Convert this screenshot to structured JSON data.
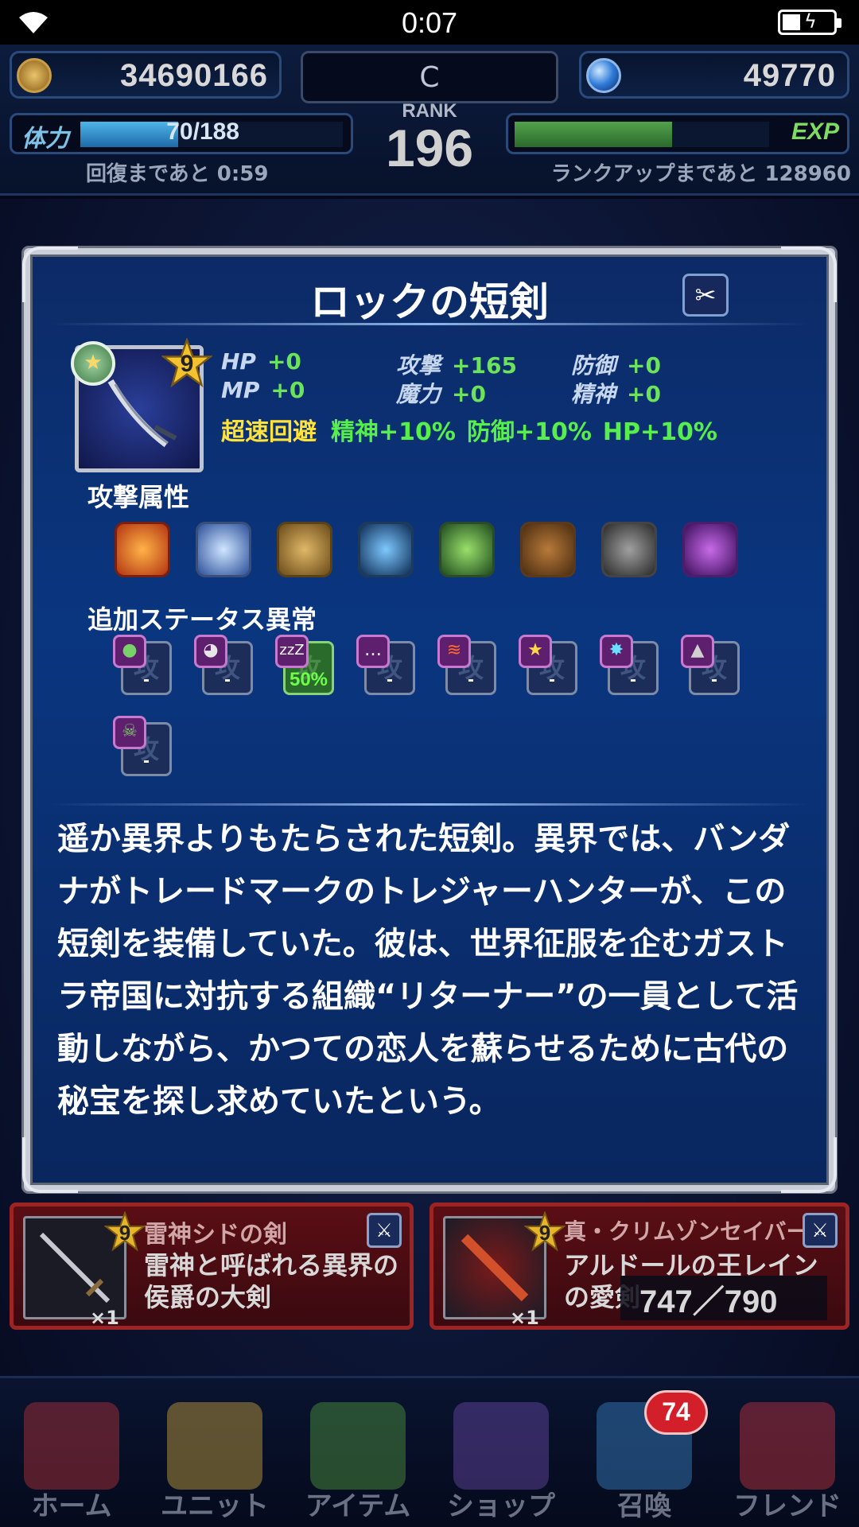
{
  "status_bar": {
    "time": "0:07"
  },
  "header": {
    "gil": "34690166",
    "gems": "49770",
    "rank_letter": "C",
    "rank_label": "RANK",
    "rank": "196",
    "stamina_label": "体力",
    "stamina": "70/188",
    "stamina_fraction": 0.372,
    "recover_text": "回復まであと 0:59",
    "exp_label": "EXP",
    "exp_fraction": 0.62,
    "rankup_text": "ランクアップまであと 128960"
  },
  "modal": {
    "title": "ロックの短剣",
    "type_icon": "dagger-icon",
    "rarity": "9",
    "stats": [
      {
        "label": "HP",
        "value": "+0"
      },
      {
        "label": "攻撃",
        "value": "+165"
      },
      {
        "label": "防御",
        "value": "+0"
      },
      {
        "label": "MP",
        "value": "+0"
      },
      {
        "label": "魔力",
        "value": "+0"
      },
      {
        "label": "精神",
        "value": "+0"
      }
    ],
    "abilities": {
      "main": "超速回避",
      "buffs": [
        "精神+10%",
        "防御+10%",
        "HP+10%"
      ]
    },
    "element_label": "攻撃属性",
    "elements": [
      "fire",
      "ice",
      "lightning",
      "water",
      "wind",
      "earth",
      "holy",
      "dark"
    ],
    "status_label": "追加ステータス異常",
    "status_kanji": "攻",
    "status_effects": [
      {
        "name": "poison",
        "icon": "●",
        "value": "-"
      },
      {
        "name": "blind",
        "icon": "◕",
        "value": "-"
      },
      {
        "name": "sleep",
        "icon": "zzZ",
        "value": "50%"
      },
      {
        "name": "silence",
        "icon": "…",
        "value": "-"
      },
      {
        "name": "paralyze",
        "icon": "≋",
        "value": "-"
      },
      {
        "name": "confuse",
        "icon": "★",
        "value": "-"
      },
      {
        "name": "disease",
        "icon": "✸",
        "value": "-"
      },
      {
        "name": "petrify",
        "icon": "▲",
        "value": "-"
      },
      {
        "name": "doom",
        "icon": "☠",
        "value": "-"
      }
    ],
    "description": "遥か異界よりもたらされた短剣。異界では、バンダナがトレードマークのトレジャーハンターが、この短剣を装備していた。彼は、世界征服を企むガストラ帝国に対抗する組織“リターナー”の一員として活動しながら、かつての恋人を蘇らせるために古代の秘宝を探し求めていたという。"
  },
  "cards": [
    {
      "rarity": "9",
      "name": "雷神シドの剣",
      "sub": "雷神と呼ばれる異界の侯爵の大剣",
      "count": "×1"
    },
    {
      "rarity": "9",
      "name": "真・クリムゾンセイバー",
      "sub": "アルドールの王レインの愛剣",
      "count": "×1"
    }
  ],
  "inventory": "747／790",
  "nav": [
    {
      "label": "ホーム",
      "color": "#b8323a"
    },
    {
      "label": "ユニット",
      "color": "#c9a43e"
    },
    {
      "label": "アイテム",
      "color": "#4f9a3e"
    },
    {
      "label": "ショップ",
      "color": "#6a4aa8"
    },
    {
      "label": "召喚",
      "color": "#3a86c8"
    },
    {
      "label": "フレンド",
      "color": "#c8343e"
    }
  ],
  "summon_badge": "74"
}
